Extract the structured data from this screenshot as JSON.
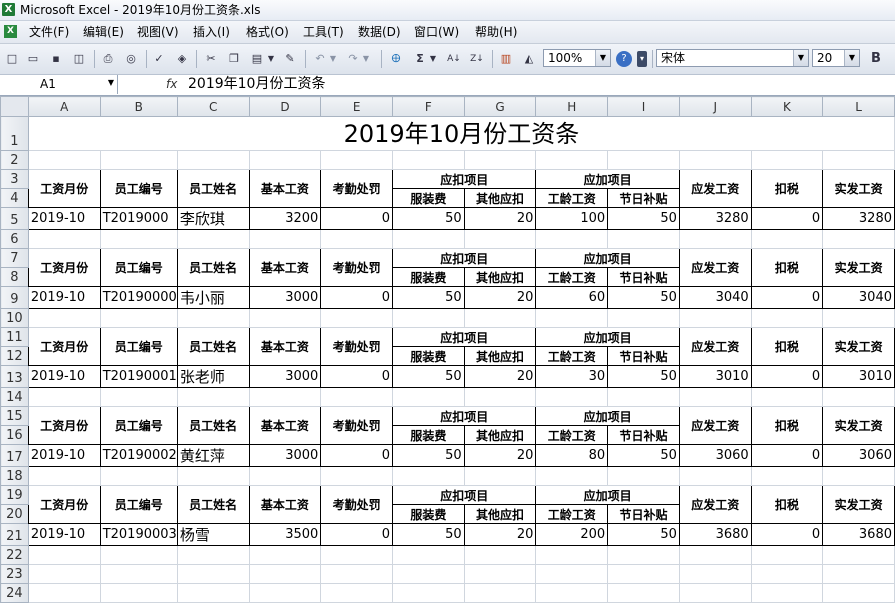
{
  "window": {
    "app_icon": "excel-icon",
    "title": "Microsoft Excel - 2019年10月份工资条.xls"
  },
  "menu": [
    "文件(F)",
    "编辑(E)",
    "视图(V)",
    "插入(I)",
    "格式(O)",
    "工具(T)",
    "数据(D)",
    "窗口(W)",
    "帮助(H)"
  ],
  "toolbar": {
    "zoom": "100%",
    "font_name": "宋体",
    "font_size": "20",
    "bold_label": "B",
    "sum_label": "Σ"
  },
  "formula_bar": {
    "cell_ref": "A1",
    "fx_label": "fx",
    "formula": "2019年10月份工资条"
  },
  "columns": [
    "A",
    "B",
    "C",
    "D",
    "E",
    "F",
    "G",
    "H",
    "I",
    "J",
    "K",
    "L"
  ],
  "sheet": {
    "title": "2019年10月份工资条",
    "headers": {
      "month": "工资月份",
      "emp_id": "员工编号",
      "emp_name": "员工姓名",
      "base_pay": "基本工资",
      "attendance_penalty": "考勤处罚",
      "deductions": "应扣项目",
      "uniform": "服装费",
      "other_deduction": "其他应扣",
      "additions": "应加项目",
      "seniority_pay": "工龄工资",
      "holiday_allowance": "节日补贴",
      "gross_pay": "应发工资",
      "tax": "扣税",
      "net_pay": "实发工资"
    },
    "employees": [
      {
        "row_labels": [
          "3",
          "4",
          "5"
        ],
        "month": "2019-10",
        "emp_id": "T2019000",
        "name": "李欣琪",
        "base": "3200",
        "penalty": "0",
        "uniform": "50",
        "other": "20",
        "seniority": "100",
        "holiday": "50",
        "gross": "3280",
        "tax": "0",
        "net": "3280"
      },
      {
        "row_labels": [
          "7",
          "8",
          "9"
        ],
        "month": "2019-10",
        "emp_id": "T20190000",
        "name": "韦小丽",
        "base": "3000",
        "penalty": "0",
        "uniform": "50",
        "other": "20",
        "seniority": "60",
        "holiday": "50",
        "gross": "3040",
        "tax": "0",
        "net": "3040"
      },
      {
        "row_labels": [
          "11",
          "12",
          "13"
        ],
        "month": "2019-10",
        "emp_id": "T20190001",
        "name": "张老师",
        "base": "3000",
        "penalty": "0",
        "uniform": "50",
        "other": "20",
        "seniority": "30",
        "holiday": "50",
        "gross": "3010",
        "tax": "0",
        "net": "3010"
      },
      {
        "row_labels": [
          "15",
          "16",
          "17"
        ],
        "month": "2019-10",
        "emp_id": "T20190002",
        "name": "黄红萍",
        "base": "3000",
        "penalty": "0",
        "uniform": "50",
        "other": "20",
        "seniority": "80",
        "holiday": "50",
        "gross": "3060",
        "tax": "0",
        "net": "3060"
      },
      {
        "row_labels": [
          "19",
          "20",
          "21"
        ],
        "month": "2019-10",
        "emp_id": "T20190003",
        "name": "杨雪",
        "base": "3500",
        "penalty": "0",
        "uniform": "50",
        "other": "20",
        "seniority": "200",
        "holiday": "50",
        "gross": "3680",
        "tax": "0",
        "net": "3680"
      }
    ],
    "spacer_rows": [
      "2",
      "6",
      "10",
      "14",
      "18"
    ],
    "trailing_rows": [
      "22",
      "23",
      "24"
    ]
  }
}
